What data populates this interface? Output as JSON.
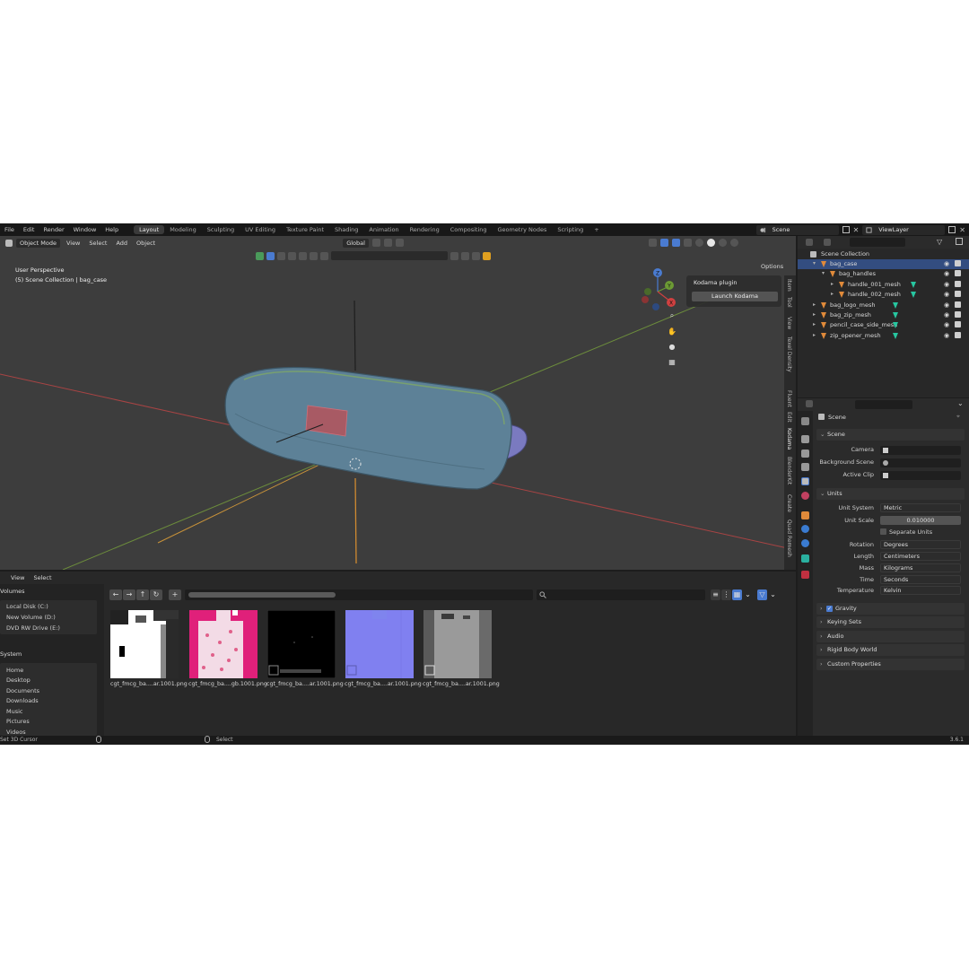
{
  "menu": [
    "File",
    "Edit",
    "Render",
    "Window",
    "Help"
  ],
  "workspaces": [
    "Layout",
    "Modeling",
    "Sculpting",
    "UV Editing",
    "Texture Paint",
    "Shading",
    "Animation",
    "Rendering",
    "Compositing",
    "Geometry Nodes",
    "Scripting"
  ],
  "active_workspace": "Layout",
  "add_tab": "+",
  "scene_name": "Scene",
  "view_layer": "ViewLayer",
  "viewport": {
    "mode": "Object Mode",
    "menus": [
      "View",
      "Select",
      "Add",
      "Object"
    ],
    "orientation": "Global",
    "perspective_label": "User Perspective",
    "collection_label": "(5) Scene Collection | bag_case",
    "options": "Options"
  },
  "kodama": {
    "title": "Kodama plugin",
    "button": "Launch Kodama"
  },
  "sidebar_tabs": [
    "Item",
    "Tool",
    "View",
    "Texel Density",
    "Fluent",
    "Edit",
    "Kodama",
    "BlenderKit",
    "Create",
    "Quad Remesh"
  ],
  "active_sidebar_tab": "Kodama",
  "gizmo": {
    "z": "Z",
    "y": "Y",
    "x": "X"
  },
  "file_browser": {
    "menus": [
      "View",
      "Select"
    ],
    "volumes_title": "Volumes",
    "volumes": [
      "Local Disk (C:)",
      "New Volume (D:)",
      "DVD RW Drive (E:)"
    ],
    "system_title": "System",
    "system": [
      "Home",
      "Desktop",
      "Documents",
      "Downloads",
      "Music",
      "Pictures",
      "Videos"
    ],
    "files": [
      {
        "name": "cgt_fmcg_ba....ar.1001.png",
        "kind": "mask"
      },
      {
        "name": "cgt_fmcg_ba....gb.1001.png",
        "kind": "pink"
      },
      {
        "name": "cgt_fmcg_ba....ar.1001.png",
        "kind": "black"
      },
      {
        "name": "cgt_fmcg_ba....ar.1001.png",
        "kind": "normal"
      },
      {
        "name": "cgt_fmcg_ba....ar.1001.png",
        "kind": "gray"
      }
    ]
  },
  "outliner": {
    "root": "Scene Collection",
    "items": [
      {
        "name": "bag_case",
        "depth": 1,
        "selected": true,
        "has_vg": false,
        "expanded": true
      },
      {
        "name": "bag_handles",
        "depth": 2,
        "selected": false,
        "has_vg": false,
        "expanded": true
      },
      {
        "name": "handle_001_mesh",
        "depth": 3,
        "selected": false,
        "has_vg": true,
        "expanded": false
      },
      {
        "name": "handle_002_mesh",
        "depth": 3,
        "selected": false,
        "has_vg": true,
        "expanded": false
      },
      {
        "name": "bag_logo_mesh",
        "depth": 1,
        "selected": false,
        "has_vg": true,
        "expanded": false
      },
      {
        "name": "bag_zip_mesh",
        "depth": 1,
        "selected": false,
        "has_vg": true,
        "expanded": false
      },
      {
        "name": "pencil_case_side_mesh",
        "depth": 1,
        "selected": false,
        "has_vg": true,
        "expanded": false
      },
      {
        "name": "zip_opener_mesh",
        "depth": 1,
        "selected": false,
        "has_vg": true,
        "expanded": false
      }
    ]
  },
  "properties": {
    "context": "Scene",
    "scene_panel": "Scene",
    "camera_label": "Camera",
    "background_scene_label": "Background Scene",
    "active_clip_label": "Active Clip",
    "units_panel": "Units",
    "unit_system_label": "Unit System",
    "unit_system": "Metric",
    "unit_scale_label": "Unit Scale",
    "unit_scale": "0.010000",
    "separate_units": "Separate Units",
    "rotation_label": "Rotation",
    "rotation": "Degrees",
    "length_label": "Length",
    "length": "Centimeters",
    "mass_label": "Mass",
    "mass": "Kilograms",
    "time_label": "Time",
    "time": "Seconds",
    "temperature_label": "Temperature",
    "temperature": "Kelvin",
    "gravity": "Gravity",
    "collapsed_panels": [
      "Keying Sets",
      "Audio",
      "Rigid Body World",
      "Custom Properties"
    ]
  },
  "status": {
    "left": "Set 3D Cursor",
    "mid": "Select",
    "version": "3.6.1"
  },
  "colors": {
    "accent": "#4a7bd0",
    "selection": "#334d80",
    "mesh": "#e08a3a",
    "vertex_group": "#27c6a0",
    "bag": "#5d8197",
    "handle": "#7a7ac0",
    "logo": "#b0565e"
  }
}
